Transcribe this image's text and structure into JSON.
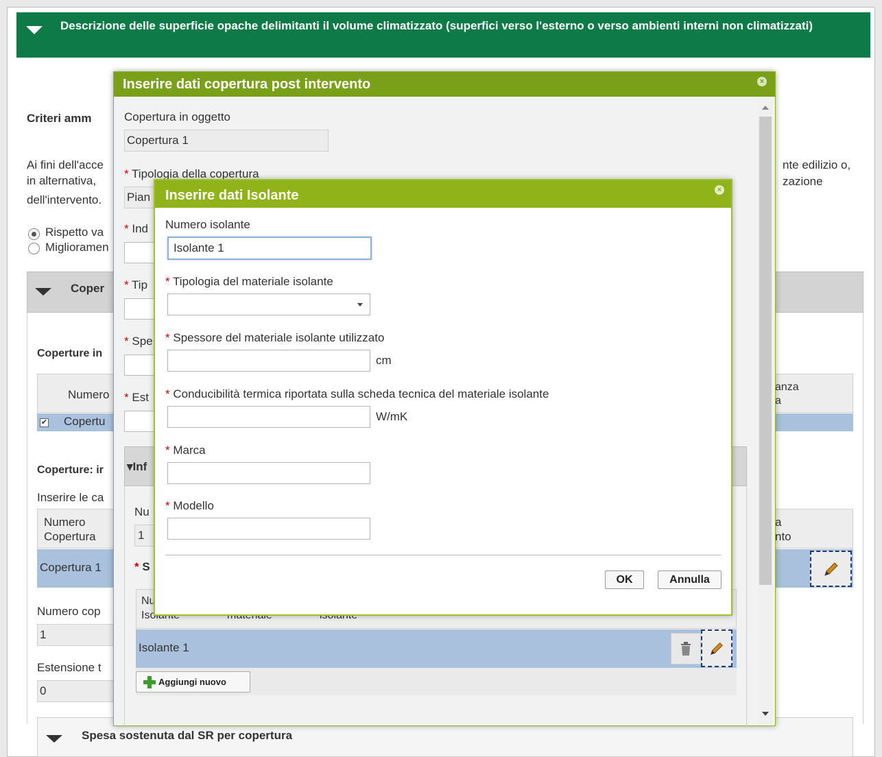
{
  "main_section": {
    "title": "Descrizione delle superficie opache delimitanti il volume climatizzato (superfici verso l'esterno o verso ambienti interni non climatizzati)"
  },
  "background": {
    "criteri_heading": "Criteri amm",
    "para_line1": "Ai fini dell'acce",
    "para_line2": "in alternativa,",
    "para_line3": "dell'intervento.",
    "para_right1": "nte edilizio o,",
    "para_right2": "zazione",
    "radio1_label": "Rispetto va",
    "radio2_label": "Miglioramen",
    "coperture_section": "Coper",
    "coperture_in_label": "Coperture in",
    "table1_col_numero": "Numero",
    "table1_col_right_1": "anza",
    "table1_col_right_2": "a",
    "table1_row_label": "Copertu",
    "coperture_info_label": "Coperture: ir",
    "inserire_label": "Inserire le ca",
    "table2_col1_line1": "Numero",
    "table2_col1_line2": "Copertura",
    "table2_col_right_1": "a",
    "table2_col_right_2": "nto",
    "table2_row_label": "Copertura 1",
    "numero_cop_label": "Numero cop",
    "numero_cop_value": "1",
    "estensione_label": "Estensione t",
    "estensione_value": "0",
    "spesa_section": "Spesa sostenuta dal SR per copertura"
  },
  "dialog1": {
    "title": "Inserire dati copertura post intervento",
    "copertura_label": "Copertura in oggetto",
    "copertura_value": "Copertura 1",
    "tipologia_label": "Tipologia della copertura",
    "tipologia_value": "Pian",
    "ind_label": "Ind",
    "tip_label": "Tip",
    "spe_label": "Spe",
    "est_label": "Est",
    "info_section": "Inf",
    "nu_label": "Nu",
    "nu_value": "1",
    "s_label": "S",
    "iso_table_head_1": "Nu",
    "iso_table_head_2": "Isolante",
    "iso_table_head_3": "materiale",
    "iso_table_head_4": "isolante",
    "iso_row_label": "Isolante 1",
    "add_button": "Aggiungi nuovo"
  },
  "dialog2": {
    "title": "Inserire dati Isolante",
    "numero_label": "Numero isolante",
    "numero_value": "Isolante 1",
    "tipologia_label": "Tipologia del materiale isolante",
    "spessore_label": "Spessore del materiale isolante utilizzato",
    "spessore_unit": "cm",
    "conducibilita_label": "Conducibilità termica riportata sulla scheda tecnica del materiale isolante",
    "conducibilita_unit": "W/mK",
    "marca_label": "Marca",
    "modello_label": "Modello",
    "required_mark": "*",
    "ok_button": "OK",
    "cancel_button": "Annulla"
  },
  "colors": {
    "main_header": "#0d7a47",
    "dialog1_header": "#7aa01a",
    "dialog2_header": "#8fb319",
    "selected_row": "#a9c1dc"
  },
  "icons": {
    "collapse": "triangle-down-icon",
    "close": "close-icon",
    "edit": "pencil-icon",
    "delete": "trash-icon",
    "add": "plus-icon",
    "dropdown": "chevron-down-icon",
    "checkbox": "checkmark-icon"
  }
}
